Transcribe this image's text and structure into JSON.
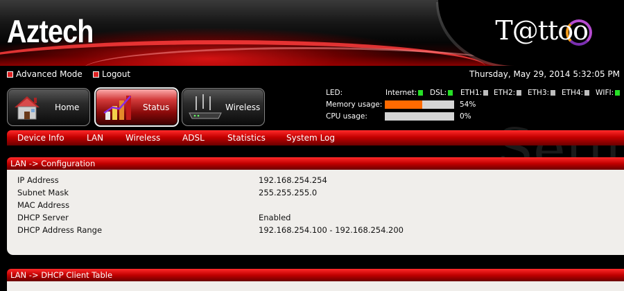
{
  "header": {
    "brand": "Aztech",
    "logo": "T@ttoo"
  },
  "topbar": {
    "advanced_mode": "Advanced Mode",
    "logout": "Logout",
    "datetime": "Thursday, May 29, 2014 5:32:05 PM"
  },
  "nav": [
    {
      "label": "Home",
      "icon": "house-icon"
    },
    {
      "label": "Status",
      "icon": "bar-chart-icon",
      "active": true
    },
    {
      "label": "Wireless",
      "icon": "router-icon"
    }
  ],
  "status": {
    "led_label": "LED:",
    "leds": [
      {
        "label": "Internet:",
        "state": "on"
      },
      {
        "label": "DSL:",
        "state": "on"
      },
      {
        "label": "ETH1:",
        "state": "off"
      },
      {
        "label": "ETH2:",
        "state": "off"
      },
      {
        "label": "ETH3:",
        "state": "off"
      },
      {
        "label": "ETH4:",
        "state": "off"
      },
      {
        "label": "WIFI:",
        "state": "on"
      }
    ],
    "memory_label": "Memory usage:",
    "memory_value": "54%",
    "memory_fraction": 0.54,
    "cpu_label": "CPU usage:",
    "cpu_value": "0%",
    "cpu_fraction": 0.0,
    "led_on_color": "#26e026",
    "bar_color": "#ff6a00"
  },
  "watermark": "Setup",
  "menu": [
    "Device Info",
    "LAN",
    "Wireless",
    "ADSL",
    "Statistics",
    "System Log"
  ],
  "lan_config": {
    "title": "LAN -> Configuration",
    "rows": [
      {
        "label": "IP Address",
        "value": "192.168.254.254"
      },
      {
        "label": "Subnet Mask",
        "value": "255.255.255.0"
      },
      {
        "label": "MAC Address",
        "value": ""
      },
      {
        "label": "DHCP Server",
        "value": "Enabled"
      },
      {
        "label": "DHCP Address Range",
        "value": "192.168.254.100 - 192.168.254.200"
      }
    ]
  },
  "dhcp_table": {
    "title": "LAN -> DHCP Client Table"
  }
}
